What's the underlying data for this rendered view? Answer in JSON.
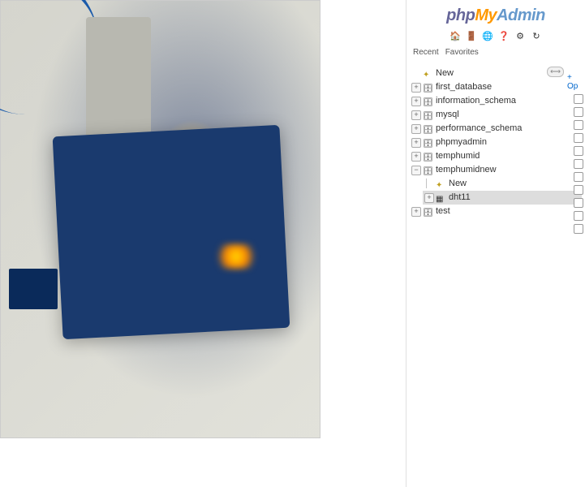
{
  "logo": {
    "php": "php",
    "my": "My",
    "admin": "Admin"
  },
  "toolbar_icons": [
    "home-icon",
    "logout-icon",
    "query-icon",
    "docs-icon",
    "settings-icon",
    "reload-icon"
  ],
  "tabs": {
    "recent": "Recent",
    "favorites": "Favorites"
  },
  "collapse_label": "⟷",
  "options_link": "+ Op",
  "tree": {
    "new_label": "New",
    "databases": [
      {
        "name": "first_database",
        "expanded": false
      },
      {
        "name": "information_schema",
        "expanded": false
      },
      {
        "name": "mysql",
        "expanded": false
      },
      {
        "name": "performance_schema",
        "expanded": false
      },
      {
        "name": "phpmyadmin",
        "expanded": false
      },
      {
        "name": "temphumid",
        "expanded": false
      },
      {
        "name": "temphumidnew",
        "expanded": true,
        "children_new": "New",
        "tables": [
          {
            "name": "dht11",
            "selected": true
          }
        ]
      },
      {
        "name": "test",
        "expanded": false
      }
    ]
  }
}
